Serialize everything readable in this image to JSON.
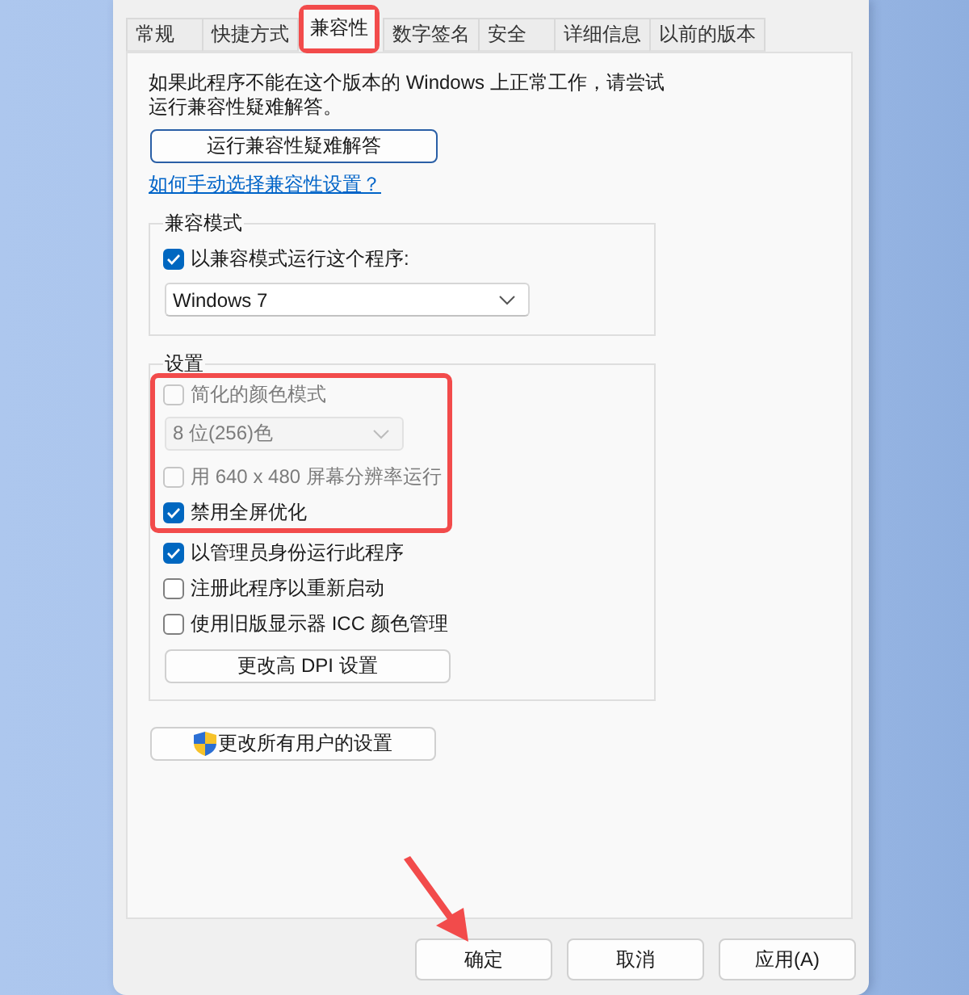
{
  "tabs": [
    {
      "label": "常规",
      "selected": false,
      "highlighted": false
    },
    {
      "label": "快捷方式",
      "selected": false,
      "highlighted": false
    },
    {
      "label": "兼容性",
      "selected": true,
      "highlighted": true
    },
    {
      "label": "数字签名",
      "selected": false,
      "highlighted": false
    },
    {
      "label": "安全",
      "selected": false,
      "highlighted": false
    },
    {
      "label": "详细信息",
      "selected": false,
      "highlighted": false
    },
    {
      "label": "以前的版本",
      "selected": false,
      "highlighted": false
    }
  ],
  "intro": "如果此程序不能在这个版本的 Windows 上正常工作，请尝试运行兼容性疑难解答。",
  "troubleshoot_button": {
    "label": "运行兼容性疑难解答",
    "focused": true
  },
  "help_link": "如何手动选择兼容性设置？",
  "compat_mode": {
    "title": "兼容模式",
    "checkbox": {
      "label": "以兼容模式运行这个程序:",
      "checked": true
    },
    "dropdown": {
      "value": "Windows 7",
      "disabled": false
    }
  },
  "settings": {
    "title": "设置",
    "items": [
      {
        "kind": "checkbox",
        "label": "简化的颜色模式",
        "checked": false,
        "disabled": true,
        "highlighted": true
      },
      {
        "kind": "dropdown",
        "value": "8 位(256)色",
        "disabled": true,
        "highlighted": true
      },
      {
        "kind": "checkbox",
        "label": "用 640 x 480 屏幕分辨率运行",
        "checked": false,
        "disabled": true,
        "highlighted": true
      },
      {
        "kind": "checkbox",
        "label": "禁用全屏优化",
        "checked": true,
        "disabled": false,
        "highlighted": true
      },
      {
        "kind": "checkbox",
        "label": "以管理员身份运行此程序",
        "checked": true,
        "disabled": false,
        "highlighted": false
      },
      {
        "kind": "checkbox",
        "label": "注册此程序以重新启动",
        "checked": false,
        "disabled": false,
        "highlighted": false
      },
      {
        "kind": "checkbox",
        "label": "使用旧版显示器 ICC 颜色管理",
        "checked": false,
        "disabled": false,
        "highlighted": false
      },
      {
        "kind": "button",
        "label": "更改高 DPI 设置",
        "highlighted": false
      }
    ]
  },
  "all_users_button": {
    "label": "更改所有用户的设置"
  },
  "buttons": [
    {
      "label": "确定",
      "arrow": true
    },
    {
      "label": "取消",
      "arrow": false
    },
    {
      "label": "应用(A)",
      "arrow": false
    }
  ]
}
